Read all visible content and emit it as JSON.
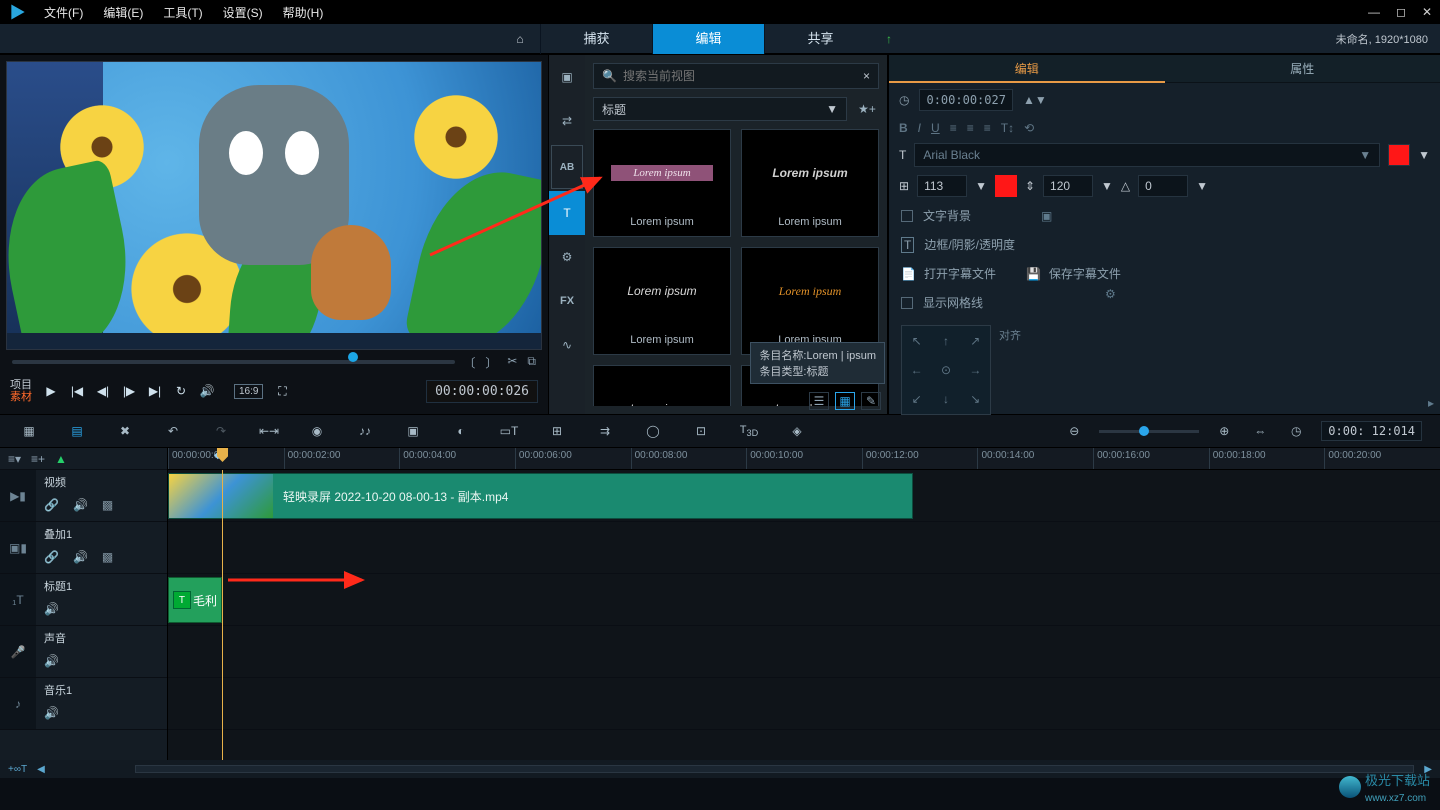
{
  "menu": {
    "file": "文件(F)",
    "edit": "编辑(E)",
    "tools": "工具(T)",
    "settings": "设置(S)",
    "help": "帮助(H)"
  },
  "tabs": {
    "capture": "捕获",
    "edit": "编辑",
    "share": "共享"
  },
  "project_info": "未命名, 1920*1080",
  "preview": {
    "project": "项目",
    "material": "素材",
    "ratio": "16:9",
    "timecode": "00:00:00:026"
  },
  "library": {
    "search_placeholder": "搜索当前视图",
    "category": "标题",
    "thumbs": [
      "Lorem ipsum",
      "Lorem ipsum",
      "Lorem ipsum",
      "Lorem ipsum",
      "Lorem ipsum",
      "Lorem | ipsum"
    ],
    "tooltip_name": "条目名称:Lorem | ipsum",
    "tooltip_type": "条目类型:标题"
  },
  "props": {
    "tab_edit": "编辑",
    "tab_attr": "属性",
    "timecode": "0:00:00:027",
    "font": "Arial Black",
    "size": "113",
    "leading": "120",
    "rotation": "0",
    "text_bg": "文字背景",
    "border": "边框/阴影/透明度",
    "open_sub": "打开字幕文件",
    "save_sub": "保存字幕文件",
    "grid": "显示网格线",
    "align": "对齐"
  },
  "toolbar_tc": "0:00: 12:014",
  "ruler": [
    "00:00:00:00",
    "00:00:02:00",
    "00:00:04:00",
    "00:00:06:00",
    "00:00:08:00",
    "00:00:10:00",
    "00:00:12:00",
    "00:00:14:00",
    "00:00:16:00",
    "00:00:18:00",
    "00:00:20:00"
  ],
  "tracks": {
    "video": "视频",
    "overlay": "叠加1",
    "title": "标题1",
    "sound": "声音",
    "music": "音乐1"
  },
  "clip_video": "轻映录屏 2022-10-20 08-00-13 - 副本.mp4",
  "clip_title": "毛利",
  "footer_btn": "+∞T",
  "watermark": "极光下载站",
  "watermark_url": "www.xz7.com"
}
